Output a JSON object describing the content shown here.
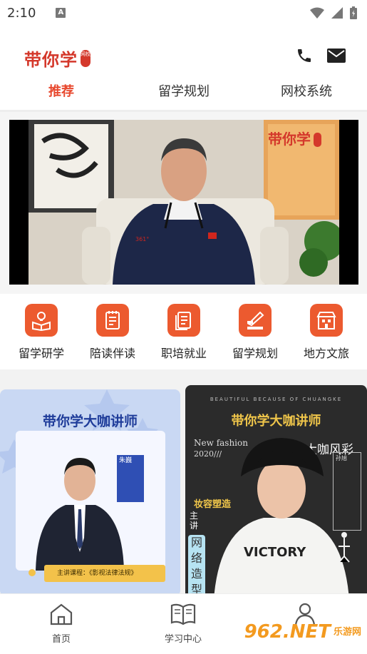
{
  "status_bar": {
    "time": "2:10",
    "notification_letter": "A"
  },
  "header": {
    "logo_text": "带你学",
    "logo_badge": "网校",
    "phone_icon": "phone-icon",
    "mail_icon": "mail-icon"
  },
  "tabs": [
    {
      "label": "推荐",
      "active": true
    },
    {
      "label": "留学规划",
      "active": false
    },
    {
      "label": "网校系统",
      "active": false
    }
  ],
  "video": {
    "watermark_text": "带你学",
    "watermark_badge": "网校"
  },
  "quick_nav": [
    {
      "label": "留学研学",
      "icon": "book-bulb-icon"
    },
    {
      "label": "陪读伴读",
      "icon": "notepad-icon"
    },
    {
      "label": "职培就业",
      "icon": "document-icon"
    },
    {
      "label": "留学规划",
      "icon": "pen-write-icon"
    },
    {
      "label": "地方文旅",
      "icon": "building-icon"
    }
  ],
  "cards": {
    "left": {
      "title": "带你学大咖讲师",
      "name": "朱巍",
      "bottom_text": "主讲课程：《影视法律法规》"
    },
    "right": {
      "top_line": "BEAUTIFUL BECAUSE OF CHUANGKE",
      "title": "带你学大咖讲师",
      "fashion": "New fashion",
      "year": "2020///",
      "daka": "大咖风彩",
      "style": "妆容塑造",
      "main": "主讲",
      "wangluo": "网络造型",
      "name_box": "孙旭"
    }
  },
  "bottom_nav": [
    {
      "label": "首页",
      "icon": "home-icon"
    },
    {
      "label": "学习中心",
      "icon": "open-book-icon"
    },
    {
      "label": "我的",
      "icon": "person-icon"
    }
  ],
  "site_watermark": {
    "big": "962.NET",
    "small": "乐游网"
  },
  "colors": {
    "accent": "#e8492f",
    "brand_red": "#d4382b",
    "icon_bg": "#ec5a2f"
  }
}
